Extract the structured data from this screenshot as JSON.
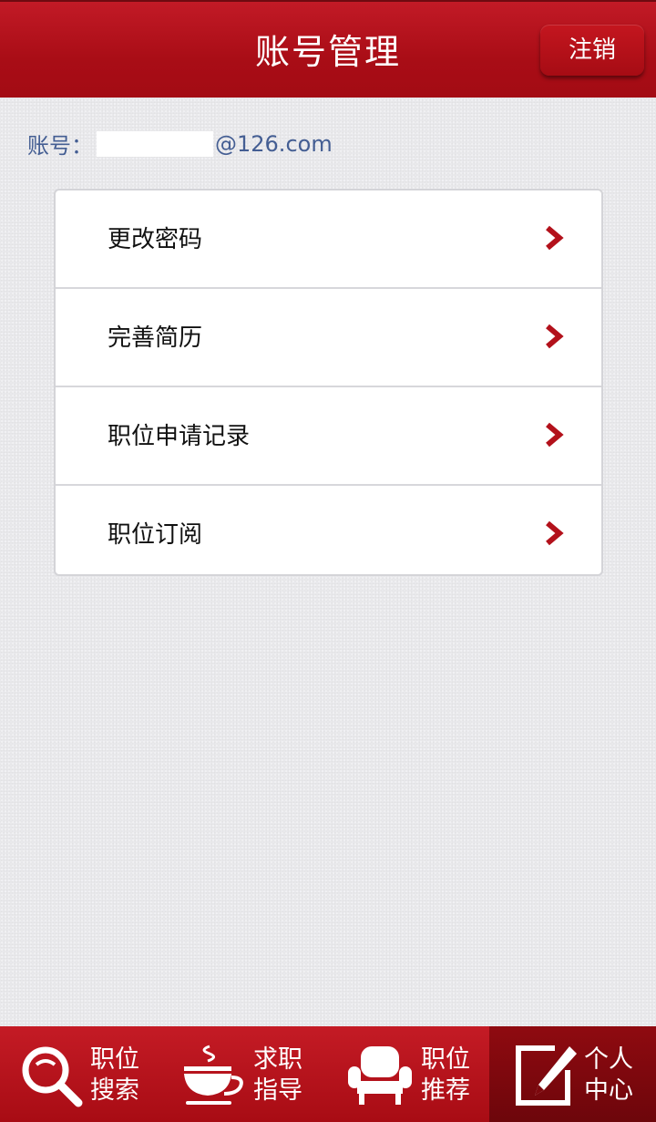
{
  "header": {
    "title": "账号管理",
    "logout_label": "注销"
  },
  "account": {
    "label": "账号：",
    "email_suffix": "@126.com"
  },
  "menu": [
    {
      "label": "更改密码",
      "icon": "chevron-right-icon"
    },
    {
      "label": "完善简历",
      "icon": "chevron-right-icon"
    },
    {
      "label": "职位申请记录",
      "icon": "chevron-right-icon"
    },
    {
      "label": "职位订阅",
      "icon": "chevron-right-icon"
    }
  ],
  "tabs": [
    {
      "line1": "职位",
      "line2": "搜索",
      "icon": "search-icon",
      "active": false
    },
    {
      "line1": "求职",
      "line2": "指导",
      "icon": "coffee-cup-icon",
      "active": false
    },
    {
      "line1": "职位",
      "line2": "推荐",
      "icon": "armchair-icon",
      "active": false
    },
    {
      "line1": "个人",
      "line2": "中心",
      "icon": "edit-note-icon",
      "active": true
    }
  ],
  "colors": {
    "brand_red": "#b3111b",
    "active_tab": "#7d080d",
    "account_text": "#445e93",
    "chevron": "#b3111b"
  }
}
